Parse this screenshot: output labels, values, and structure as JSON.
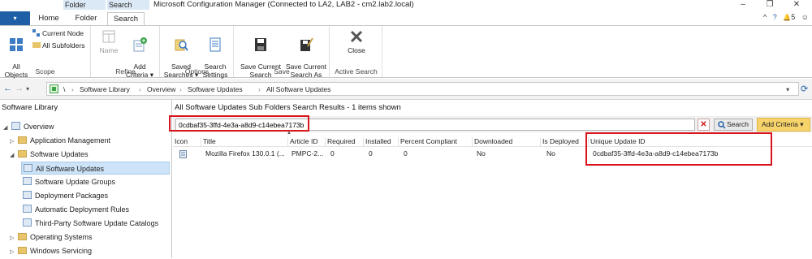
{
  "titlebar": {
    "context_tabs": [
      "Folder Tools",
      "Search Tools"
    ],
    "title": "Microsoft Configuration Manager (Connected to LA2, LAB2 - cm2.lab2.local)",
    "controls": {
      "minimize": "–",
      "restore": "❐",
      "close": "✕"
    }
  },
  "ribbon_tabs": {
    "file_menu": "▾",
    "tabs": [
      "Home",
      "Folder",
      "Search"
    ],
    "right": {
      "collapse": "^",
      "help": "?",
      "notifications": "5",
      "notify_icon": "🔔",
      "feedback": "☺"
    }
  },
  "ribbon": {
    "scope": {
      "label": "Scope",
      "all_objects": "All\nObjects",
      "current_node": "Current Node",
      "all_subfolders": "All Subfolders"
    },
    "refine": {
      "label": "Refine",
      "name": "Name",
      "add_criteria": "Add\nCriteria ▾"
    },
    "options": {
      "label": "Options",
      "saved_searches": "Saved\nSearches ▾",
      "search_settings": "Search\nSettings"
    },
    "save": {
      "label": "Save",
      "save_current_search": "Save Current\nSearch",
      "save_current_search_as": "Save Current\nSearch As"
    },
    "active_search": {
      "label": "Active Search",
      "close": "Close"
    }
  },
  "address": {
    "back": "←",
    "forward": "→",
    "dropdown": "▾",
    "crumbs": [
      "\\",
      "Software Library",
      "Overview",
      "Software Updates",
      "All Software Updates"
    ],
    "separator": "›",
    "refresh": "⟳"
  },
  "left_pane": {
    "header": "Software Library",
    "tree": [
      {
        "label": "Overview",
        "expander": "◢",
        "level": 0
      },
      {
        "label": "Application Management",
        "expander": "▷",
        "level": 1
      },
      {
        "label": "Software Updates",
        "expander": "◢",
        "level": 1
      },
      {
        "label": "All Software Updates",
        "expander": "",
        "level": 2,
        "selected": true
      },
      {
        "label": "Software Update Groups",
        "expander": "",
        "level": 2
      },
      {
        "label": "Deployment Packages",
        "expander": "",
        "level": 2
      },
      {
        "label": "Automatic Deployment Rules",
        "expander": "",
        "level": 2
      },
      {
        "label": "Third-Party Software Update Catalogs",
        "expander": "",
        "level": 2
      },
      {
        "label": "Operating Systems",
        "expander": "▷",
        "level": 1
      },
      {
        "label": "Windows Servicing",
        "expander": "▷",
        "level": 1
      }
    ]
  },
  "results": {
    "header": "All Software Updates Sub Folders Search Results  -  1 items shown",
    "search_value": "0cdbaf35-3ffd-4e3a-a8d9-c14ebea7173b",
    "clear_icon": "✕",
    "search_button": "Search",
    "add_criteria": "Add Criteria ▾",
    "columns": [
      "Icon",
      "Title",
      "Article ID",
      "Required",
      "Installed",
      "Percent Compliant",
      "Downloaded",
      "Is Deployed",
      "Unique Update ID"
    ],
    "rows": [
      {
        "title": "Mozilla Firefox 130.0.1 (...",
        "article_id": "PMPC-2...",
        "required": "0",
        "installed": "0",
        "percent_compliant": "0",
        "downloaded": "No",
        "is_deployed": "No",
        "unique_update_id": "0cdbaf35-3ffd-4e3a-a8d9-c14ebea7173b"
      }
    ]
  },
  "colors": {
    "accent": "#1e5fa6",
    "highlight": "#d9141c",
    "add_criteria": "#f7d36b"
  }
}
